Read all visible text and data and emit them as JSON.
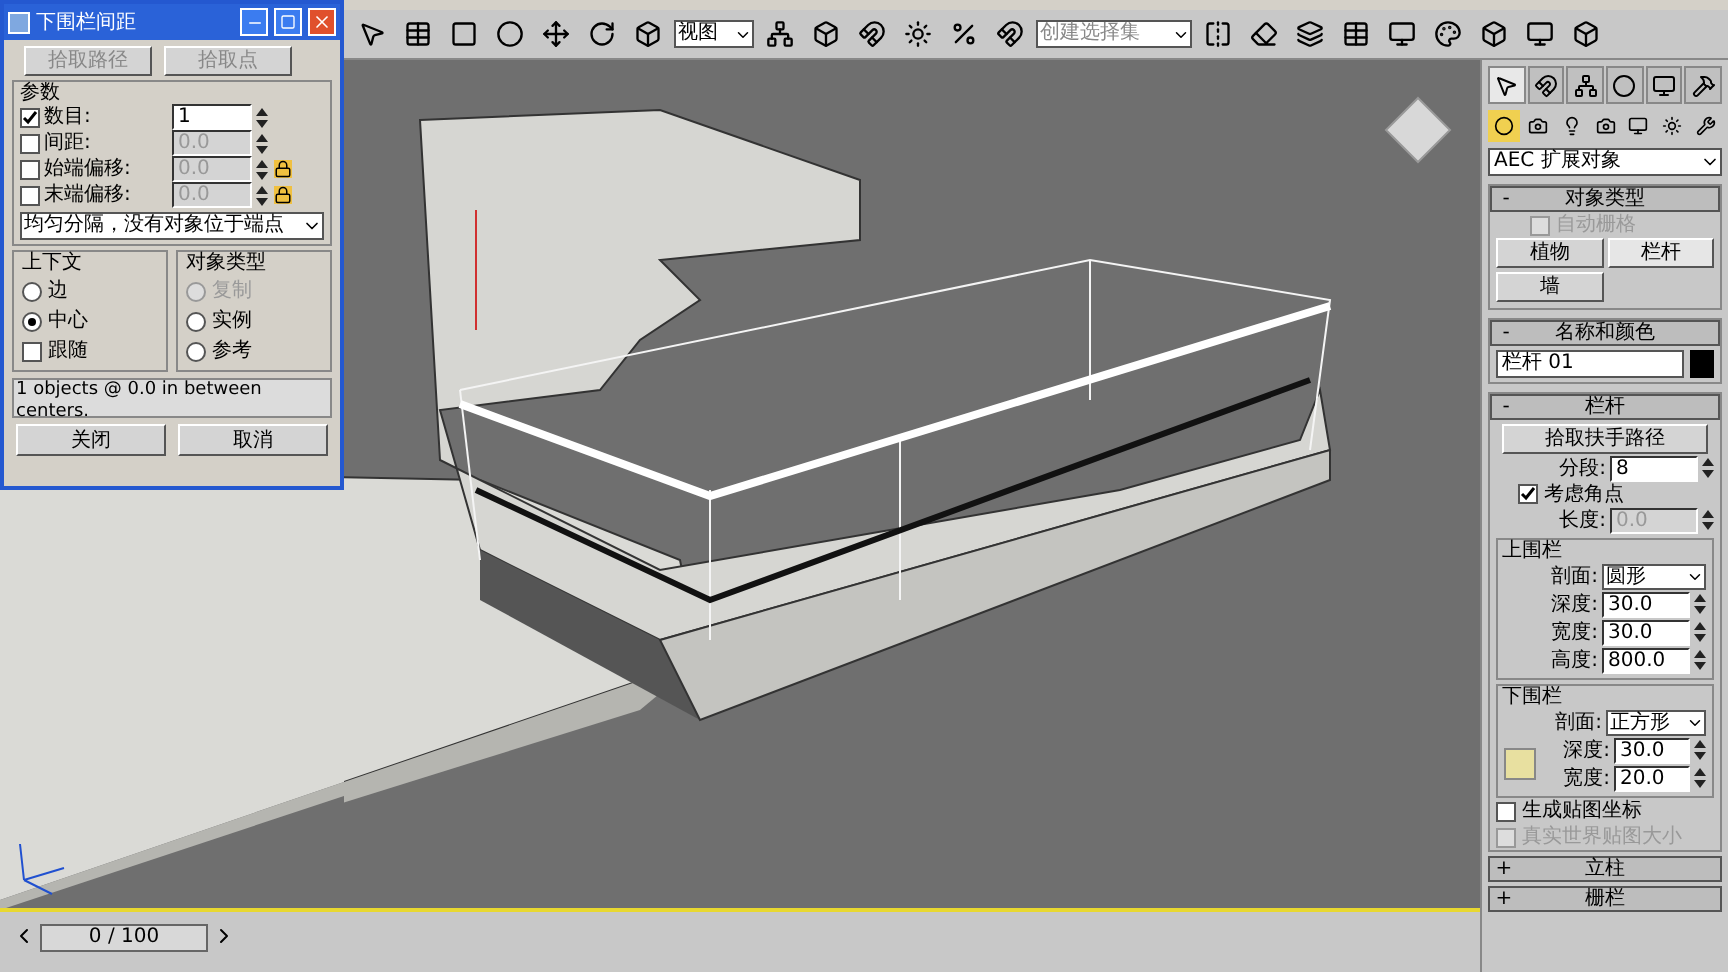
{
  "toolbar": {
    "view_dropdown": "视图",
    "selection_set": "创建选择集"
  },
  "dialog": {
    "title": "下围栏间距",
    "pick_path": "拾取路径",
    "pick_points": "拾取点",
    "params_title": "参数",
    "params": [
      {
        "label": "数目:",
        "checked": true,
        "value": "1",
        "lock": false
      },
      {
        "label": "间距:",
        "checked": false,
        "value": "0.0",
        "lock": false
      },
      {
        "label": "始端偏移:",
        "checked": false,
        "value": "0.0",
        "lock": true
      },
      {
        "label": "末端偏移:",
        "checked": false,
        "value": "0.0",
        "lock": true
      }
    ],
    "distribution": "均匀分隔，没有对象位于端点",
    "context_title": "上下文",
    "context": [
      {
        "label": "边",
        "kind": "radio",
        "selected": false
      },
      {
        "label": "中心",
        "kind": "radio",
        "selected": true
      },
      {
        "label": "跟随",
        "kind": "checkbox",
        "checked": false
      }
    ],
    "object_type_title": "对象类型",
    "object_types": [
      {
        "label": "复制",
        "selected": false,
        "disabled": true
      },
      {
        "label": "实例",
        "selected": false,
        "disabled": false
      },
      {
        "label": "参考",
        "selected": false,
        "disabled": false
      }
    ],
    "status": "1 objects @ 0.0 in between centers.",
    "buttons": [
      "关闭",
      "取消"
    ]
  },
  "panel": {
    "tabs": [
      {
        "selected": true
      },
      {
        "selected": false
      },
      {
        "selected": false
      },
      {
        "selected": false
      },
      {
        "selected": false
      },
      {
        "selected": false
      }
    ],
    "categories": [
      {
        "selected": true
      },
      {
        "selected": false
      },
      {
        "selected": false
      },
      {
        "selected": false
      },
      {
        "selected": false
      },
      {
        "selected": false
      },
      {
        "selected": false
      }
    ],
    "category": "AEC 扩展对象",
    "object_type": {
      "toggle": "-",
      "title": "对象类型",
      "auto_grid": {
        "label": "自动栅格",
        "checked": false,
        "disabled": true
      },
      "buttons": [
        {
          "label": "植物",
          "selected": false
        },
        {
          "label": "栏杆",
          "selected": true
        },
        {
          "label": "墙",
          "selected": false
        }
      ]
    },
    "name_color": {
      "toggle": "-",
      "title": "名称和颜色",
      "name": "栏杆 01",
      "color": "#000000"
    },
    "railing": {
      "toggle": "-",
      "title": "栏杆",
      "pick_button": "拾取扶手路径",
      "segments_label": "分段:",
      "segments": "8",
      "respect_corners": {
        "label": "考虑角点",
        "checked": true
      },
      "length_label": "长度:",
      "length": "0.0",
      "top_rail": {
        "title": "上围栏",
        "profile_label": "剖面:",
        "profile": "圆形",
        "fields": [
          {
            "label": "深度:",
            "value": "30.0"
          },
          {
            "label": "宽度:",
            "value": "30.0"
          },
          {
            "label": "高度:",
            "value": "800.0"
          }
        ]
      },
      "lower_rail": {
        "title": "下围栏",
        "profile_label": "剖面:",
        "profile": "正方形",
        "fields": [
          {
            "label": "深度:",
            "value": "30.0"
          },
          {
            "label": "宽度:",
            "value": "20.0"
          }
        ]
      },
      "checks": [
        {
          "label": "生成贴图坐标",
          "checked": false,
          "disabled": false
        },
        {
          "label": "真实世界贴图大小",
          "checked": false,
          "disabled": true
        }
      ]
    },
    "collapsed": [
      {
        "toggle": "+",
        "title": "立柱"
      },
      {
        "toggle": "+",
        "title": "栅栏"
      }
    ]
  },
  "time_slider": {
    "frame": "0 / 100"
  }
}
